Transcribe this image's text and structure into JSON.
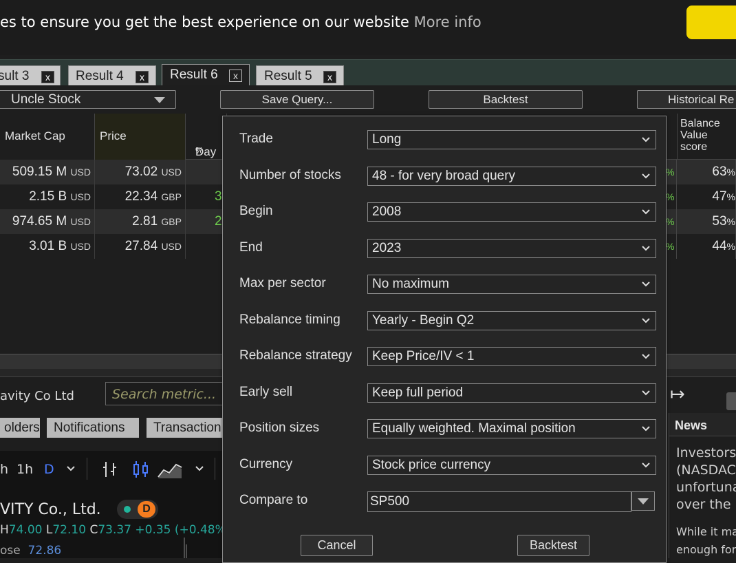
{
  "cookie": {
    "text": "es to ensure you get the best experience on our website ",
    "link": "More info",
    "accept_color": "#f2d600"
  },
  "tabs": [
    {
      "label": "sult 3",
      "close": "x"
    },
    {
      "label": "Result 4",
      "close": "x"
    },
    {
      "label": "Result 6",
      "close": "x",
      "active": true
    },
    {
      "label": "Result 5",
      "close": "x"
    }
  ],
  "toolbar": {
    "query_select": "Uncle Stock",
    "save_query": "Save Query...",
    "backtest": "Backtest",
    "historical": "Historical Re"
  },
  "table": {
    "headers": {
      "market_cap": "Market Cap",
      "price": "Price",
      "day": "Day",
      "day_unit": "%",
      "balance": "Balance Value score"
    },
    "rows": [
      {
        "mc": "509.15",
        "mc_unit": "M",
        "mc_cur": "USD",
        "price": "73.02",
        "price_cur": "USD",
        "day": "",
        "pct": "%",
        "bv": "63",
        "bv_unit": "%"
      },
      {
        "mc": "2.15",
        "mc_unit": "B",
        "mc_cur": "USD",
        "price": "22.34",
        "price_cur": "GBP",
        "day": "3",
        "pct": "%",
        "bv": "47",
        "bv_unit": "%"
      },
      {
        "mc": "974.65",
        "mc_unit": "M",
        "mc_cur": "USD",
        "price": "2.81",
        "price_cur": "GBP",
        "day": "2",
        "pct": "%",
        "bv": "53",
        "bv_unit": "%"
      },
      {
        "mc": "3.01",
        "mc_unit": "B",
        "mc_cur": "USD",
        "price": "27.84",
        "price_cur": "USD",
        "day": "",
        "pct": "%",
        "bv": "44",
        "bv_unit": "%"
      }
    ]
  },
  "lower": {
    "company": "avity Co Ltd",
    "metric_placeholder": "Search metric...",
    "tabs": [
      "olders",
      "Notifications",
      "Transaction"
    ],
    "chart_toolbar": {
      "h": "h",
      "tf_1h": "1h",
      "tf_d": "D"
    },
    "symbol": "VITY Co., Ltd.",
    "badge": "D",
    "ohlc": {
      "h_label": "H",
      "h": "74.00",
      "l_label": "L",
      "l": "72.10",
      "c_label": "C",
      "c": "73.37",
      "chg": "+0.35 (+0.48%"
    },
    "close_label": "ose",
    "close_value": "72.86"
  },
  "news": {
    "title": "News",
    "lines": [
      "Investors",
      "(NASDAC",
      "unfortuna",
      "over the l"
    ],
    "lines2": [
      "While it ma",
      "enough for"
    ]
  },
  "dialog": {
    "fields": [
      {
        "label": "Trade",
        "value": "Long"
      },
      {
        "label": "Number of stocks",
        "value": "48 - for very broad query"
      },
      {
        "label": "Begin",
        "value": "2008"
      },
      {
        "label": "End",
        "value": "2023"
      },
      {
        "label": "Max per sector",
        "value": "No maximum"
      },
      {
        "label": "Rebalance timing",
        "value": "Yearly - Begin Q2"
      },
      {
        "label": "Rebalance strategy",
        "value": "Keep Price/IV < 1"
      },
      {
        "label": "Early sell",
        "value": "Keep full period"
      },
      {
        "label": "Position sizes",
        "value": "Equally weighted. Maximal position"
      },
      {
        "label": "Currency",
        "value": "Stock price currency"
      }
    ],
    "compare": {
      "label": "Compare to",
      "value": "SP500"
    },
    "cancel": "Cancel",
    "backtest": "Backtest"
  }
}
